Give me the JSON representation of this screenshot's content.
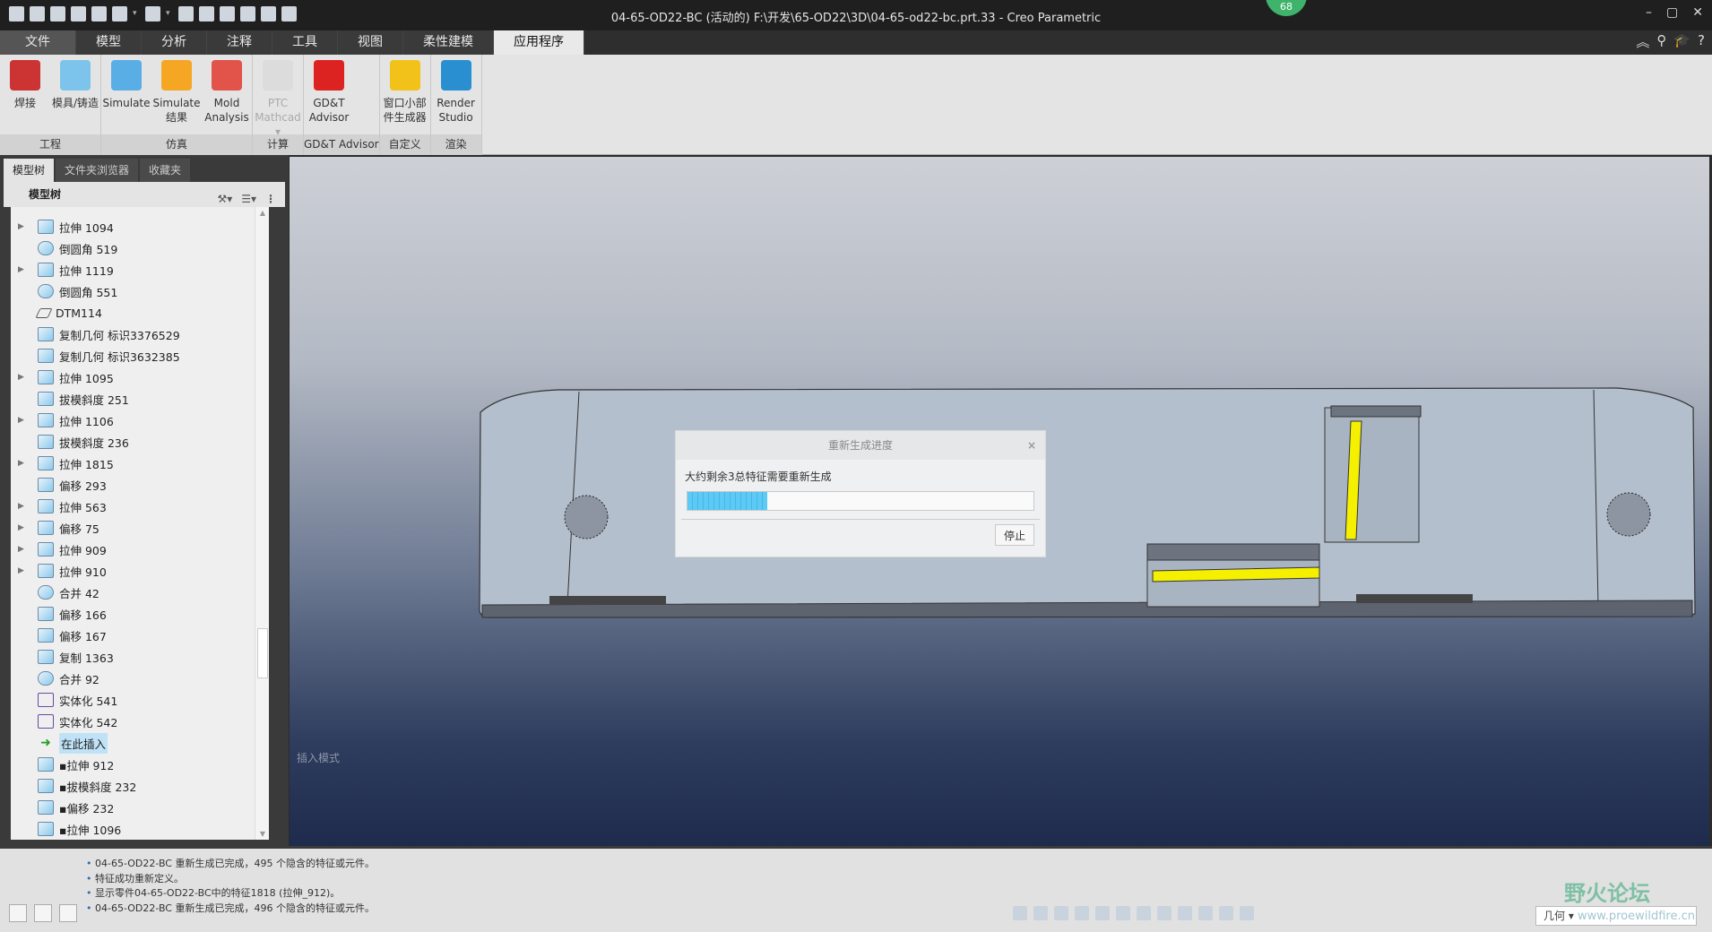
{
  "window": {
    "title": "04-65-OD22-BC (活动的) F:\\开发\\65-OD22\\3D\\04-65-od22-bc.prt.33 - Creo Parametric",
    "badge": "68",
    "controls": [
      "–",
      "▢",
      "✕"
    ]
  },
  "tabs": [
    "文件",
    "模型",
    "分析",
    "注释",
    "工具",
    "视图",
    "柔性建模",
    "应用程序"
  ],
  "active_tab": "应用程序",
  "ribbon": {
    "groups": [
      {
        "label": "工程",
        "buttons": [
          {
            "label": "焊接",
            "icon": "weld-icon",
            "color": "#c33"
          },
          {
            "label": "模具/铸造",
            "icon": "mold-cast-icon",
            "color": "#7cc4ec"
          }
        ]
      },
      {
        "label": "仿真",
        "buttons": [
          {
            "label": "Simulate",
            "icon": "simulate-icon",
            "color": "#5aaee6"
          },
          {
            "label": "Simulate 结果",
            "icon": "simulate-results-icon",
            "color": "#f5a623"
          },
          {
            "label": "Mold Analysis",
            "icon": "mold-analysis-icon",
            "color": "#e2534a"
          }
        ]
      },
      {
        "label": "计算",
        "buttons": [
          {
            "label": "PTC Mathcad ▾",
            "icon": "mathcad-icon",
            "color": "#dcdcdc",
            "disabled": true
          }
        ]
      },
      {
        "label": "GD&T Advisor",
        "buttons": [
          {
            "label": "GD&T Advisor",
            "icon": "gdt-advisor-icon",
            "color": "#d22"
          }
        ]
      },
      {
        "label": "自定义",
        "buttons": [
          {
            "label": "窗口小部件生成器",
            "icon": "widget-builder-icon",
            "color": "#f2c21b"
          }
        ]
      },
      {
        "label": "渲染",
        "buttons": [
          {
            "label": "Render Studio",
            "icon": "render-studio-icon",
            "color": "#2a8fd0"
          }
        ]
      }
    ]
  },
  "panel": {
    "tabs": [
      "模型树",
      "文件夹浏览器",
      "收藏夹"
    ],
    "header": "模型树",
    "tree": [
      {
        "label": "拉伸 1094",
        "icon": "extrude",
        "expand": true
      },
      {
        "label": "倒圆角 519",
        "icon": "round"
      },
      {
        "label": "拉伸 1119",
        "icon": "extrude",
        "expand": true
      },
      {
        "label": "倒圆角 551",
        "icon": "round"
      },
      {
        "label": "DTM114",
        "icon": "plane"
      },
      {
        "label": "复制几何 标识3376529",
        "icon": "copy-geom"
      },
      {
        "label": "复制几何 标识3632385",
        "icon": "copy-geom"
      },
      {
        "label": "拉伸 1095",
        "icon": "extrude",
        "expand": true
      },
      {
        "label": "拔模斜度 251",
        "icon": "draft"
      },
      {
        "label": "拉伸 1106",
        "icon": "extrude",
        "expand": true
      },
      {
        "label": "拔模斜度 236",
        "icon": "draft"
      },
      {
        "label": "拉伸 1815",
        "icon": "extrude",
        "expand": true
      },
      {
        "label": "偏移 293",
        "icon": "offset"
      },
      {
        "label": "拉伸 563",
        "icon": "extrude",
        "expand": true
      },
      {
        "label": "偏移 75",
        "icon": "offset",
        "expand": true
      },
      {
        "label": "拉伸 909",
        "icon": "extrude",
        "expand": true
      },
      {
        "label": "拉伸 910",
        "icon": "extrude",
        "expand": true
      },
      {
        "label": "合并 42",
        "icon": "merge"
      },
      {
        "label": "偏移 166",
        "icon": "offset"
      },
      {
        "label": "偏移 167",
        "icon": "offset"
      },
      {
        "label": "复制 1363",
        "icon": "copy"
      },
      {
        "label": "合并 92",
        "icon": "merge"
      },
      {
        "label": "实体化 541",
        "icon": "solidify"
      },
      {
        "label": "实体化 542",
        "icon": "solidify"
      },
      {
        "label": "在此插入",
        "icon": "insert-here",
        "selected": true
      },
      {
        "label": "▪拉伸 912",
        "icon": "extrude"
      },
      {
        "label": "▪拔模斜度 232",
        "icon": "draft"
      },
      {
        "label": "▪偏移 232",
        "icon": "offset"
      },
      {
        "label": "▪拉伸 1096",
        "icon": "extrude"
      }
    ]
  },
  "viewport": {
    "mode_label": "插入模式",
    "accent": "#f5f000"
  },
  "dialog": {
    "title": "重新生成进度",
    "message": "大约剩余3总特征需要重新生成",
    "progress_percent": 23,
    "stop_label": "停止",
    "close": "×"
  },
  "messages": [
    "04-65-OD22-BC 重新生成已完成，495 个隐含的特征或元件。",
    "特征成功重新定义。",
    "显示零件04-65-OD22-BC中的特征1818 (拉伸_912)。",
    "04-65-OD22-BC 重新生成已完成，496 个隐含的特征或元件。"
  ],
  "filter": {
    "value": "几何"
  },
  "watermark": {
    "text": "野火论坛",
    "url": "www.proewildfire.cn"
  }
}
